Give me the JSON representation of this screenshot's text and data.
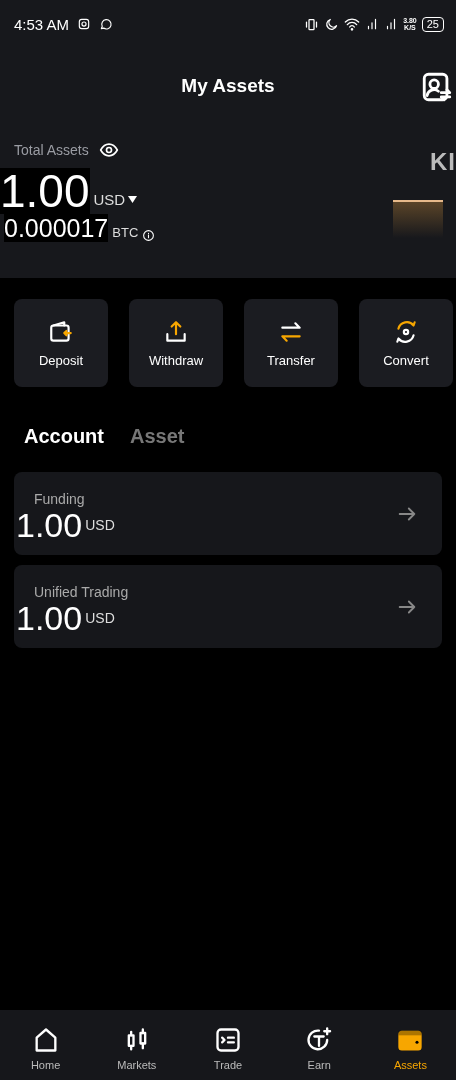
{
  "status_bar": {
    "time": "4:53 AM",
    "speed_value": "3.80",
    "speed_unit": "K/S",
    "battery": "25"
  },
  "header": {
    "title": "My Assets"
  },
  "summary": {
    "label": "Total Assets",
    "amount": "1.00",
    "currency": "USD",
    "btc_amount": "0.000017",
    "btc_unit": "BTC",
    "banner_text": "KI"
  },
  "actions": [
    {
      "label": "Deposit",
      "kind": "deposit"
    },
    {
      "label": "Withdraw",
      "kind": "withdraw"
    },
    {
      "label": "Transfer",
      "kind": "transfer"
    },
    {
      "label": "Convert",
      "kind": "convert"
    }
  ],
  "tabs": [
    {
      "label": "Account",
      "selected": true
    },
    {
      "label": "Asset",
      "selected": false
    }
  ],
  "accounts": [
    {
      "name": "Funding",
      "amount": "1.00",
      "currency": "USD"
    },
    {
      "name": "Unified Trading",
      "amount": "1.00",
      "currency": "USD"
    }
  ],
  "bottom_nav": [
    {
      "label": "Home",
      "kind": "home",
      "selected": false
    },
    {
      "label": "Markets",
      "kind": "markets",
      "selected": false
    },
    {
      "label": "Trade",
      "kind": "trade",
      "selected": false
    },
    {
      "label": "Earn",
      "kind": "earn",
      "selected": false
    },
    {
      "label": "Assets",
      "kind": "assets",
      "selected": true
    }
  ]
}
